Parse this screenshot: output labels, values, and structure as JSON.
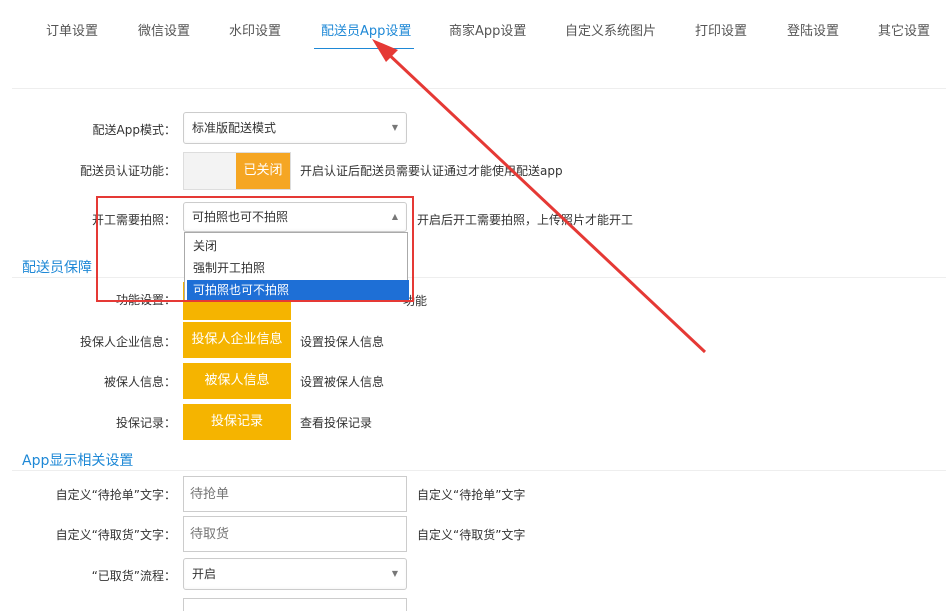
{
  "tabs": [
    {
      "label": "订单设置"
    },
    {
      "label": "微信设置"
    },
    {
      "label": "水印设置"
    },
    {
      "label": "配送员App设置"
    },
    {
      "label": "商家App设置"
    },
    {
      "label": "自定义系统图片"
    },
    {
      "label": "打印设置"
    },
    {
      "label": "登陆设置"
    },
    {
      "label": "其它设置"
    }
  ],
  "colors": {
    "accent": "#1e88d6",
    "orange": "#f5a623",
    "yellow": "#f5b400",
    "highlight": "#e53935"
  },
  "form": {
    "app_mode": {
      "label": "配送App模式：",
      "value": "标准版配送模式"
    },
    "auth": {
      "label": "配送员认证功能：",
      "state": "已关闭",
      "help": "开启认证后配送员需要认证通过才能使用配送app"
    },
    "photo": {
      "label": "开工需要拍照：",
      "value": "可拍照也可不拍照",
      "help": "开启后开工需要拍照，上传照片才能开工",
      "options": [
        "关闭",
        "强制开工拍照",
        "可拍照也可不拍照"
      ]
    }
  },
  "insurance": {
    "title": "配送员保障",
    "function": {
      "label": "功能设置：",
      "help": "功能"
    },
    "company": {
      "label": "投保人企业信息：",
      "button": "投保人企业信息",
      "help": "设置投保人信息"
    },
    "insured": {
      "label": "被保人信息：",
      "button": "被保人信息",
      "help": "设置被保人信息"
    },
    "records": {
      "label": "投保记录：",
      "button": "投保记录",
      "help": "查看投保记录"
    }
  },
  "app_display": {
    "title": "App显示相关设置",
    "wait_grab": {
      "label": "自定义“待抢单”文字：",
      "placeholder": "待抢单",
      "help": "自定义“待抢单”文字"
    },
    "wait_pick": {
      "label": "自定义“待取货”文字：",
      "placeholder": "待取货",
      "help": "自定义“待取货”文字"
    },
    "picked_flow": {
      "label": "“已取货”流程：",
      "value": "开启"
    }
  }
}
